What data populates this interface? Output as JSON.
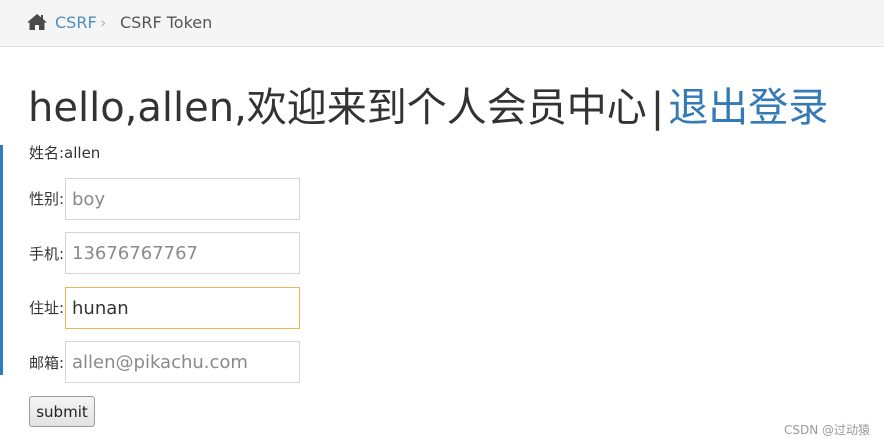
{
  "breadcrumb": {
    "home_icon": "home-icon",
    "link_label": "CSRF",
    "separator": "›",
    "current_label": "CSRF Token"
  },
  "header": {
    "greeting": "hello,allen,欢迎来到个人会员中心",
    "separator": "|",
    "logout_label": "退出登录"
  },
  "profile": {
    "name_line": "姓名:allen",
    "fields": [
      {
        "label": "性别:",
        "value": "",
        "placeholder": "boy"
      },
      {
        "label": "手机:",
        "value": "",
        "placeholder": "13676767767"
      },
      {
        "label": "住址:",
        "value": "hunan",
        "placeholder": ""
      },
      {
        "label": "邮箱:",
        "value": "",
        "placeholder": "allen@pikachu.com"
      }
    ],
    "submit_label": "submit"
  },
  "watermark": "CSDN @过动猿",
  "colors": {
    "link": "#337ab7",
    "breadcrumb_link": "#4c8fbd",
    "focus_border": "#f0b65e",
    "accent": "#2b7dbc"
  }
}
